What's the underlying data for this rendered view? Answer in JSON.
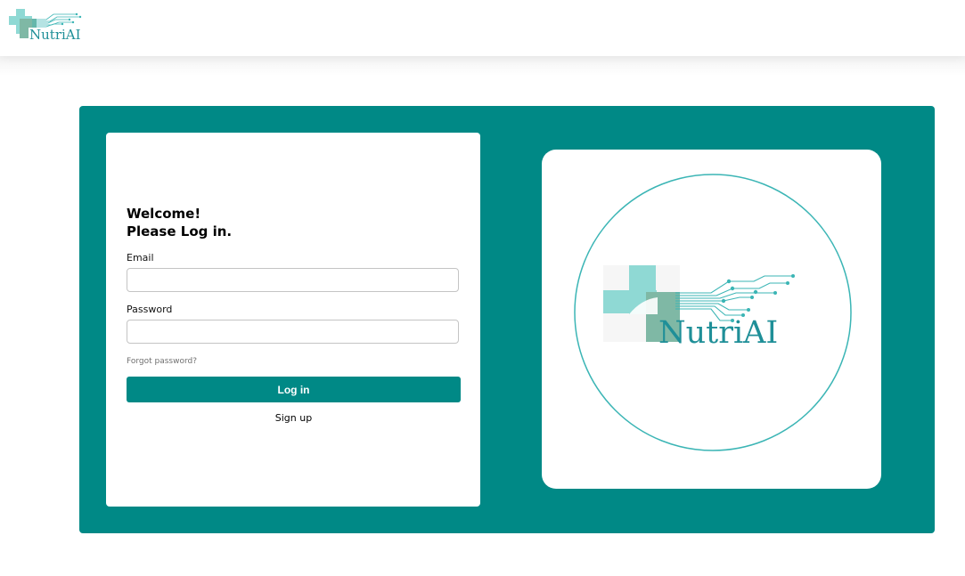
{
  "brand": {
    "name": "NutriAI",
    "colors": {
      "primary": "#008986",
      "logo_text": "#1f8f98",
      "cross_light": "#8fd9d4",
      "cross_dark": "#7fb8a5",
      "circle": "#3bb5b5"
    }
  },
  "login": {
    "heading_line1": "Welcome!",
    "heading_line2": "Please Log in.",
    "email_label": "Email",
    "email_value": "",
    "password_label": "Password",
    "password_value": "",
    "forgot_password": "Forgot password?",
    "login_button": "Log in",
    "signup_link": "Sign up"
  },
  "icons": {
    "nav_logo": "nutriai-cross-circuit-logo",
    "hero_logo": "nutriai-cross-circuit-logo"
  }
}
